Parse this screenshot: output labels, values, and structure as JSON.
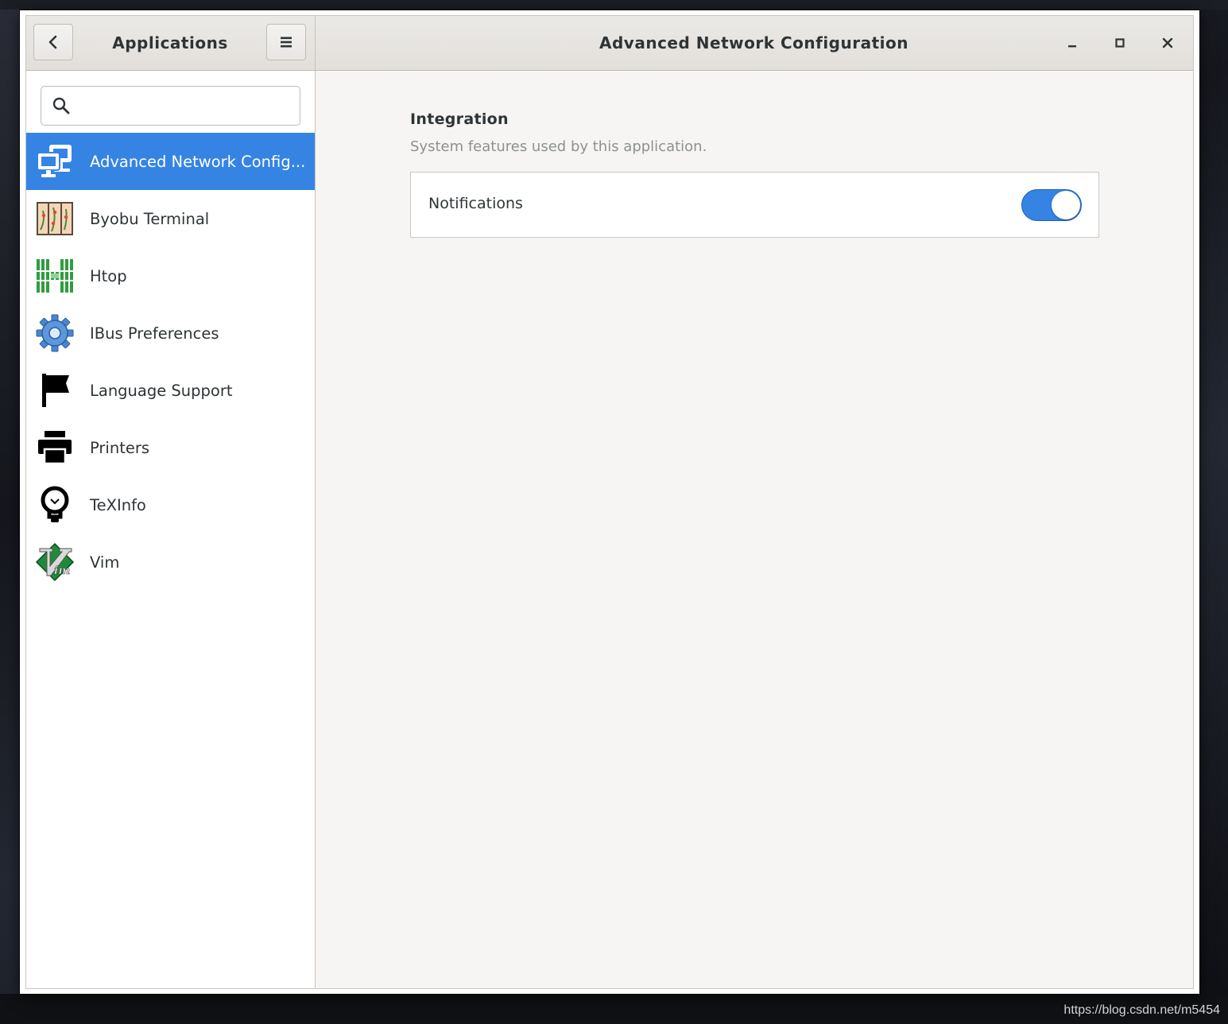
{
  "header": {
    "sidebar_title": "Applications",
    "window_title": "Advanced Network Configuration"
  },
  "search": {
    "value": ""
  },
  "apps": [
    {
      "label": "Advanced Network Config...",
      "icon": "network-computers-icon",
      "selected": true
    },
    {
      "label": "Byobu Terminal",
      "icon": "byobu-terminal-icon",
      "selected": false
    },
    {
      "label": "Htop",
      "icon": "htop-icon",
      "selected": false
    },
    {
      "label": "IBus Preferences",
      "icon": "gear-icon",
      "selected": false
    },
    {
      "label": "Language Support",
      "icon": "flag-icon",
      "selected": false
    },
    {
      "label": "Printers",
      "icon": "printer-icon",
      "selected": false
    },
    {
      "label": "TeXInfo",
      "icon": "lightbulb-icon",
      "selected": false
    },
    {
      "label": "Vim",
      "icon": "vim-icon",
      "selected": false
    }
  ],
  "integration": {
    "title": "Integration",
    "subtitle": "System features used by this application.",
    "rows": [
      {
        "label": "Notifications",
        "enabled": true
      }
    ]
  },
  "watermark": "https://blog.csdn.net/m5454",
  "colors": {
    "accent": "#3584e4",
    "headerbar": "#e8e6e3",
    "content_bg": "#f6f5f4"
  }
}
